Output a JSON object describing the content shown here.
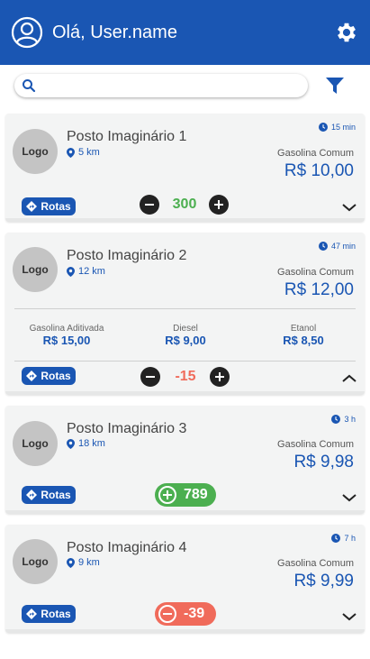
{
  "header": {
    "greeting": "Olá, User.name",
    "avatar_icon": "user-circle-icon",
    "settings_icon": "gear-icon",
    "color": "#1a56b3"
  },
  "search": {
    "placeholder": "",
    "value": "",
    "filter_icon": "filter-icon"
  },
  "stations": [
    {
      "logo": "Logo",
      "name": "Posto Imaginário 1",
      "distance": "5 km",
      "time": "15 min",
      "fuel": "Gasolina Comum",
      "price": "R$ 10,00",
      "routes_label": "Rotas",
      "vote": "300",
      "expanded": false
    },
    {
      "logo": "Logo",
      "name": "Posto Imaginário 2",
      "distance": "12 km",
      "time": "47 min",
      "fuel": "Gasolina Comum",
      "price": "R$ 12,00",
      "routes_label": "Rotas",
      "vote": "-15",
      "expanded": true,
      "others": [
        {
          "label": "Gasolina Aditivada",
          "price": "R$ 15,00"
        },
        {
          "label": "Diesel",
          "price": "R$ 9,00"
        },
        {
          "label": "Etanol",
          "price": "R$ 8,50"
        }
      ]
    },
    {
      "logo": "Logo",
      "name": "Posto Imaginário 3",
      "distance": "18 km",
      "time": "3 h",
      "fuel": "Gasolina Comum",
      "price": "R$ 9,98",
      "routes_label": "Rotas",
      "vote": "789",
      "vote_state": "up",
      "expanded": false
    },
    {
      "logo": "Logo",
      "name": "Posto Imaginário 4",
      "distance": "9 km",
      "time": "7 h",
      "fuel": "Gasolina Comum",
      "price": "R$ 9,99",
      "routes_label": "Rotas",
      "vote": "-39",
      "vote_state": "down",
      "expanded": false
    }
  ],
  "colors": {
    "primary": "#1a56b3",
    "positive": "#4caf50",
    "negative": "#f06b5b",
    "neutral_vote": "#4caf50",
    "negative_vote": "#f06b5b"
  }
}
